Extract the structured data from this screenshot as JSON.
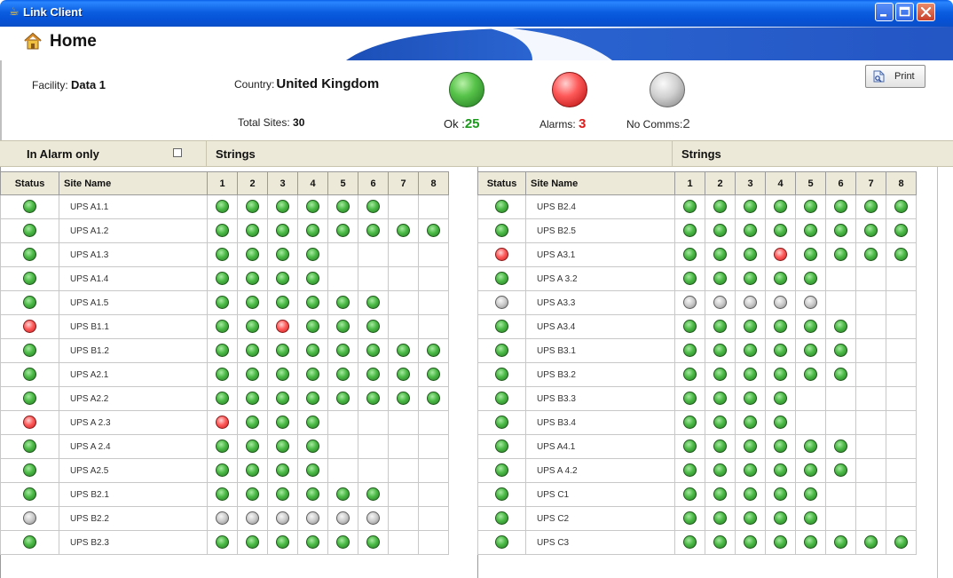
{
  "window": {
    "title": "Link Client"
  },
  "header": {
    "title": "Home"
  },
  "info": {
    "facility_label": "Facility:",
    "facility_value": "Data 1",
    "country_label": "Country:",
    "country_value": "United Kingdom",
    "total_sites_label": "Total Sites:",
    "total_sites_value": "30",
    "ok_label": "Ok :",
    "ok_value": "25",
    "alarms_label": "Alarms:",
    "alarms_value": "3",
    "nocomms_label": "No Comms:",
    "nocomms_value": "2",
    "print_label": "Print"
  },
  "section": {
    "in_alarm_only": "In Alarm only",
    "strings_left": "Strings",
    "strings_right": "Strings"
  },
  "columns": {
    "status": "Status",
    "site_name": "Site Name",
    "strings": [
      "1",
      "2",
      "3",
      "4",
      "5",
      "6",
      "7",
      "8"
    ]
  },
  "status_colors": {
    "ok": "#4cbb47",
    "alarm": "#ff5c5c",
    "no_comms": "#c9c9c9"
  },
  "left_rows": [
    {
      "site": "UPS A1.1",
      "status": "g",
      "strings": [
        "g",
        "g",
        "g",
        "g",
        "g",
        "g"
      ]
    },
    {
      "site": "UPS A1.2",
      "status": "g",
      "strings": [
        "g",
        "g",
        "g",
        "g",
        "g",
        "g",
        "g",
        "g"
      ]
    },
    {
      "site": "UPS A1.3",
      "status": "g",
      "strings": [
        "g",
        "g",
        "g",
        "g"
      ]
    },
    {
      "site": "UPS A1.4",
      "status": "g",
      "strings": [
        "g",
        "g",
        "g",
        "g"
      ]
    },
    {
      "site": "UPS A1.5",
      "status": "g",
      "strings": [
        "g",
        "g",
        "g",
        "g",
        "g",
        "g"
      ]
    },
    {
      "site": "UPS B1.1",
      "status": "r",
      "strings": [
        "g",
        "g",
        "r",
        "g",
        "g",
        "g"
      ]
    },
    {
      "site": "UPS B1.2",
      "status": "g",
      "strings": [
        "g",
        "g",
        "g",
        "g",
        "g",
        "g",
        "g",
        "g"
      ]
    },
    {
      "site": "UPS A2.1",
      "status": "g",
      "strings": [
        "g",
        "g",
        "g",
        "g",
        "g",
        "g",
        "g",
        "g"
      ]
    },
    {
      "site": "UPS A2.2",
      "status": "g",
      "strings": [
        "g",
        "g",
        "g",
        "g",
        "g",
        "g",
        "g",
        "g"
      ]
    },
    {
      "site": "UPS A 2.3",
      "status": "r",
      "strings": [
        "r",
        "g",
        "g",
        "g"
      ]
    },
    {
      "site": "UPS A 2.4",
      "status": "g",
      "strings": [
        "g",
        "g",
        "g",
        "g"
      ]
    },
    {
      "site": "UPS A2.5",
      "status": "g",
      "strings": [
        "g",
        "g",
        "g",
        "g"
      ]
    },
    {
      "site": "UPS B2.1",
      "status": "g",
      "strings": [
        "g",
        "g",
        "g",
        "g",
        "g",
        "g"
      ]
    },
    {
      "site": "UPS B2.2",
      "status": "x",
      "strings": [
        "x",
        "x",
        "x",
        "x",
        "x",
        "x"
      ]
    },
    {
      "site": "UPS B2.3",
      "status": "g",
      "strings": [
        "g",
        "g",
        "g",
        "g",
        "g",
        "g"
      ]
    }
  ],
  "right_rows": [
    {
      "site": "UPS B2.4",
      "status": "g",
      "strings": [
        "g",
        "g",
        "g",
        "g",
        "g",
        "g",
        "g",
        "g"
      ]
    },
    {
      "site": "UPS B2.5",
      "status": "g",
      "strings": [
        "g",
        "g",
        "g",
        "g",
        "g",
        "g",
        "g",
        "g"
      ]
    },
    {
      "site": "UPS A3.1",
      "status": "r",
      "strings": [
        "g",
        "g",
        "g",
        "r",
        "g",
        "g",
        "g",
        "g"
      ]
    },
    {
      "site": "UPS A 3.2",
      "status": "g",
      "strings": [
        "g",
        "g",
        "g",
        "g",
        "g"
      ]
    },
    {
      "site": "UPS A3.3",
      "status": "x",
      "strings": [
        "x",
        "x",
        "x",
        "x",
        "x"
      ]
    },
    {
      "site": "UPS A3.4",
      "status": "g",
      "strings": [
        "g",
        "g",
        "g",
        "g",
        "g",
        "g"
      ]
    },
    {
      "site": "UPS B3.1",
      "status": "g",
      "strings": [
        "g",
        "g",
        "g",
        "g",
        "g",
        "g"
      ]
    },
    {
      "site": "UPS B3.2",
      "status": "g",
      "strings": [
        "g",
        "g",
        "g",
        "g",
        "g",
        "g"
      ]
    },
    {
      "site": "UPS B3.3",
      "status": "g",
      "strings": [
        "g",
        "g",
        "g",
        "g"
      ]
    },
    {
      "site": "UPS B3.4",
      "status": "g",
      "strings": [
        "g",
        "g",
        "g",
        "g"
      ]
    },
    {
      "site": "UPS A4.1",
      "status": "g",
      "strings": [
        "g",
        "g",
        "g",
        "g",
        "g",
        "g"
      ]
    },
    {
      "site": "UPS A 4.2",
      "status": "g",
      "strings": [
        "g",
        "g",
        "g",
        "g",
        "g",
        "g"
      ]
    },
    {
      "site": "UPS C1",
      "status": "g",
      "strings": [
        "g",
        "g",
        "g",
        "g",
        "g"
      ]
    },
    {
      "site": "UPS C2",
      "status": "g",
      "strings": [
        "g",
        "g",
        "g",
        "g",
        "g"
      ]
    },
    {
      "site": "UPS C3",
      "status": "g",
      "strings": [
        "g",
        "g",
        "g",
        "g",
        "g",
        "g",
        "g",
        "g"
      ]
    }
  ]
}
